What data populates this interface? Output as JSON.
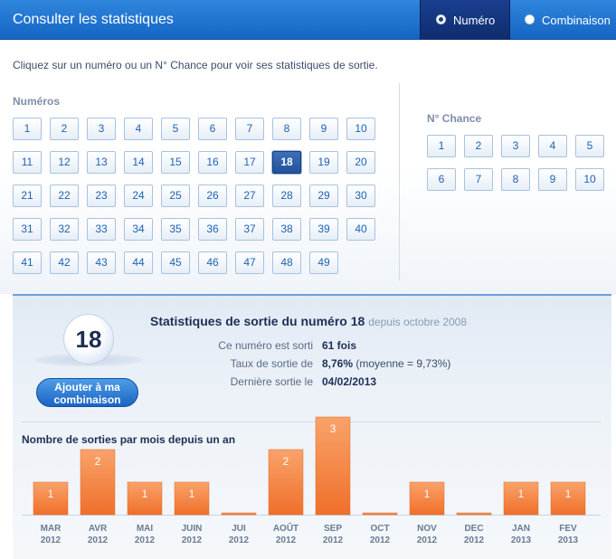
{
  "header": {
    "title": "Consulter les statistiques",
    "tabs": [
      {
        "label": "Numéro",
        "selected": true
      },
      {
        "label": "Combinaison",
        "selected": false
      }
    ]
  },
  "intro": "Cliquez sur un numéro ou un N° Chance pour voir ses statistiques de sortie.",
  "numeros": {
    "label": "Numéros",
    "items": [
      "1",
      "2",
      "3",
      "4",
      "5",
      "6",
      "7",
      "8",
      "9",
      "10",
      "11",
      "12",
      "13",
      "14",
      "15",
      "16",
      "17",
      "18",
      "19",
      "20",
      "21",
      "22",
      "23",
      "24",
      "25",
      "26",
      "27",
      "28",
      "29",
      "30",
      "31",
      "32",
      "33",
      "34",
      "35",
      "36",
      "37",
      "38",
      "39",
      "40",
      "41",
      "42",
      "43",
      "44",
      "45",
      "46",
      "47",
      "48",
      "49"
    ],
    "selected": "18"
  },
  "chance": {
    "label": "N° Chance",
    "items": [
      "1",
      "2",
      "3",
      "4",
      "5",
      "6",
      "7",
      "8",
      "9",
      "10"
    ]
  },
  "stats": {
    "ball": "18",
    "add_button": "Ajouter à ma combinaison",
    "title": "Statistiques de sortie du numéro 18",
    "since": "depuis octobre 2008",
    "rows": [
      {
        "label": "Ce numéro est sorti",
        "value": "61 fois",
        "extra": ""
      },
      {
        "label": "Taux de sortie de",
        "value": "8,76%",
        "extra": " (moyenne = 9,73%)"
      },
      {
        "label": "Dernière sortie le",
        "value": "04/02/2013",
        "extra": ""
      }
    ]
  },
  "colors": {
    "header": "#1f74d0",
    "bar_top": "#f9a36a",
    "bar_bottom": "#ef6f2a",
    "number_text": "#1e63b5"
  },
  "chart_data": {
    "type": "bar",
    "title": "Nombre de sorties par mois depuis un an",
    "categories": [
      {
        "month": "MAR",
        "year": "2012"
      },
      {
        "month": "AVR",
        "year": "2012"
      },
      {
        "month": "MAI",
        "year": "2012"
      },
      {
        "month": "JUIN",
        "year": "2012"
      },
      {
        "month": "JUI",
        "year": "2012"
      },
      {
        "month": "AOÛT",
        "year": "2012"
      },
      {
        "month": "SEP",
        "year": "2012"
      },
      {
        "month": "OCT",
        "year": "2012"
      },
      {
        "month": "NOV",
        "year": "2012"
      },
      {
        "month": "DEC",
        "year": "2012"
      },
      {
        "month": "JAN",
        "year": "2013"
      },
      {
        "month": "FEV",
        "year": "2013"
      }
    ],
    "values": [
      1,
      2,
      1,
      1,
      0,
      2,
      3,
      0,
      1,
      0,
      1,
      1
    ],
    "ylim": [
      0,
      3
    ],
    "grid": false
  }
}
